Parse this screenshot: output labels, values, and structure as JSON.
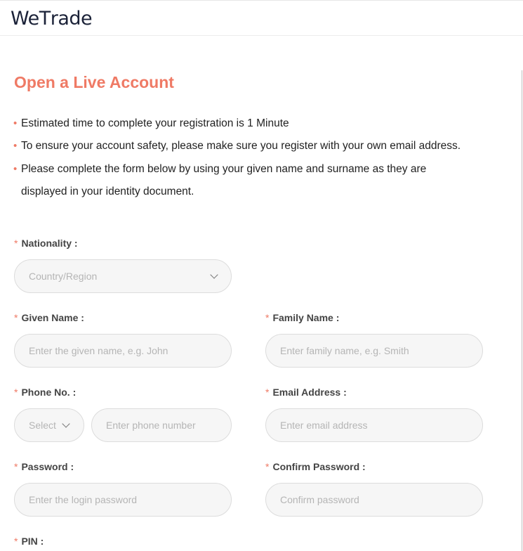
{
  "header": {
    "logo_part1": "We",
    "logo_accent": "T",
    "logo_part2": "rade",
    "brand_color": "#ef7a65"
  },
  "page": {
    "title": "Open a Live Account",
    "bullets": [
      "Estimated time to complete your registration is 1 Minute",
      "To ensure your account safety, please make sure you register with your own email address.",
      "Please complete the form below by using your given name and surname as they are",
      "displayed in your identity document."
    ],
    "bullet_glyph": "•"
  },
  "form": {
    "required_mark": "*",
    "nationality": {
      "label": "Nationality :",
      "placeholder": "Country/Region",
      "icon": "chevron-down-icon"
    },
    "given_name": {
      "label": "Given Name :",
      "placeholder": "Enter the given name, e.g. John"
    },
    "family_name": {
      "label": "Family Name :",
      "placeholder": "Enter family name, e.g. Smith"
    },
    "phone": {
      "label": "Phone No. :",
      "code_placeholder": "Select",
      "placeholder": "Enter phone number",
      "icon": "chevron-down-icon"
    },
    "email": {
      "label": "Email Address :",
      "placeholder": "Enter email address"
    },
    "password": {
      "label": "Password :",
      "placeholder": "Enter the login password"
    },
    "confirm_password": {
      "label": "Confirm Password :",
      "placeholder": "Confirm password"
    },
    "pin": {
      "label": "PIN :"
    }
  }
}
